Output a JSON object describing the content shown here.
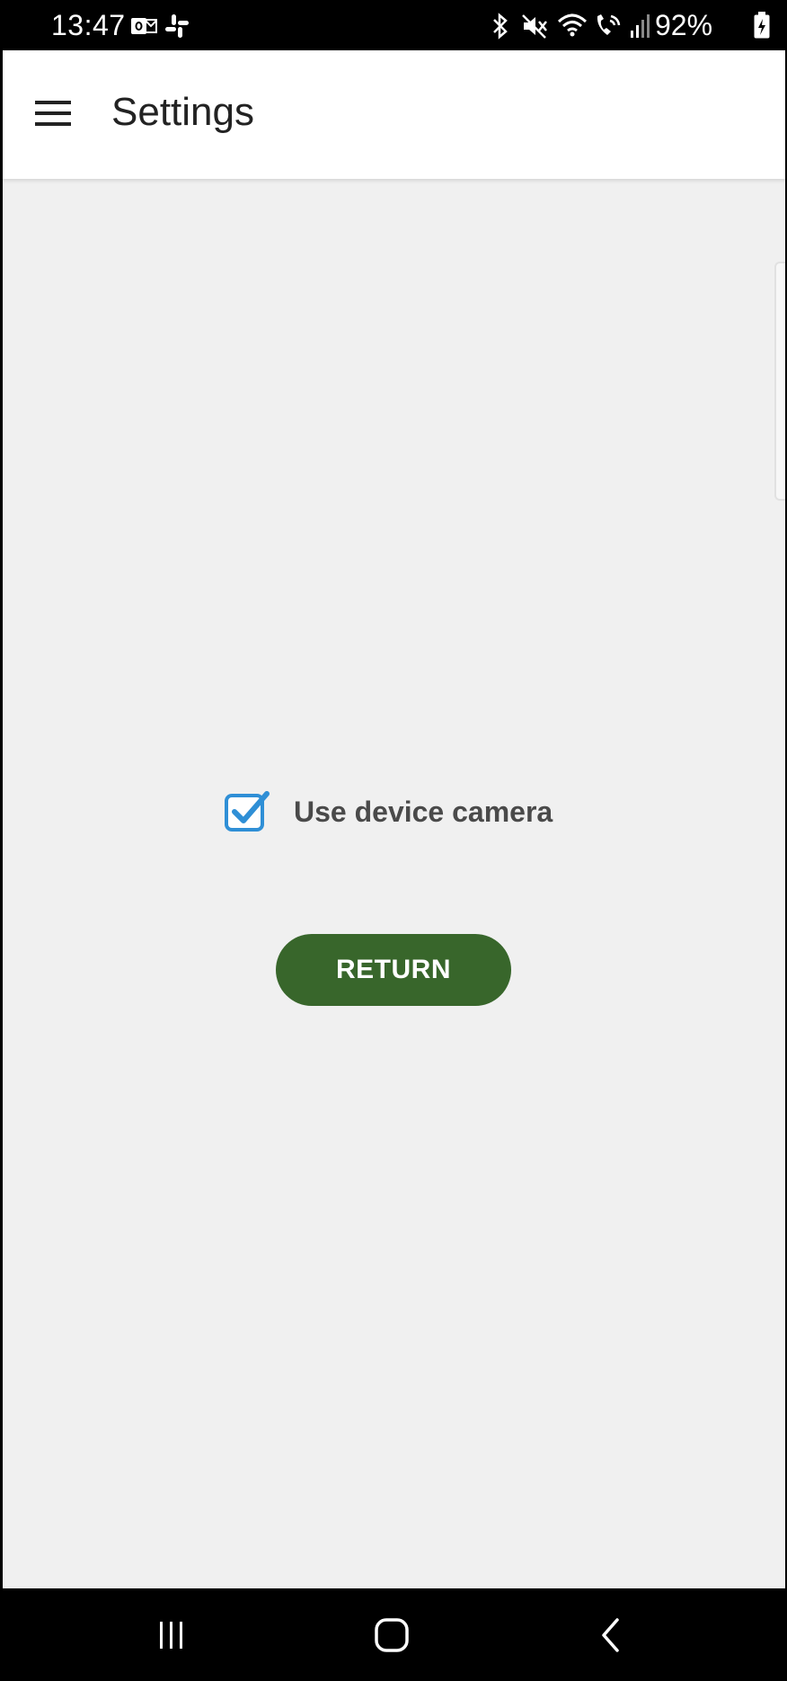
{
  "status_bar": {
    "time": "13:47",
    "battery_percent": "92%",
    "left_icons": [
      "outlook-icon",
      "slack-icon"
    ],
    "right_icons": [
      "bluetooth-icon",
      "mute-icon",
      "wifi-icon",
      "wifi-calling-icon",
      "signal-icon",
      "battery-icon"
    ]
  },
  "app_bar": {
    "title": "Settings",
    "menu_icon": "hamburger-menu-icon"
  },
  "settings": {
    "use_device_camera_label": "Use device camera",
    "use_device_camera_checked": true,
    "return_label": "RETURN"
  },
  "colors": {
    "app_bar_bg": "#ffffff",
    "content_bg": "#f0f0f0",
    "return_button_bg": "#38662b",
    "checkbox_accent": "#2f8fd6"
  },
  "nav_bar": {
    "buttons": [
      "recent-apps-icon",
      "home-icon",
      "back-icon"
    ]
  }
}
